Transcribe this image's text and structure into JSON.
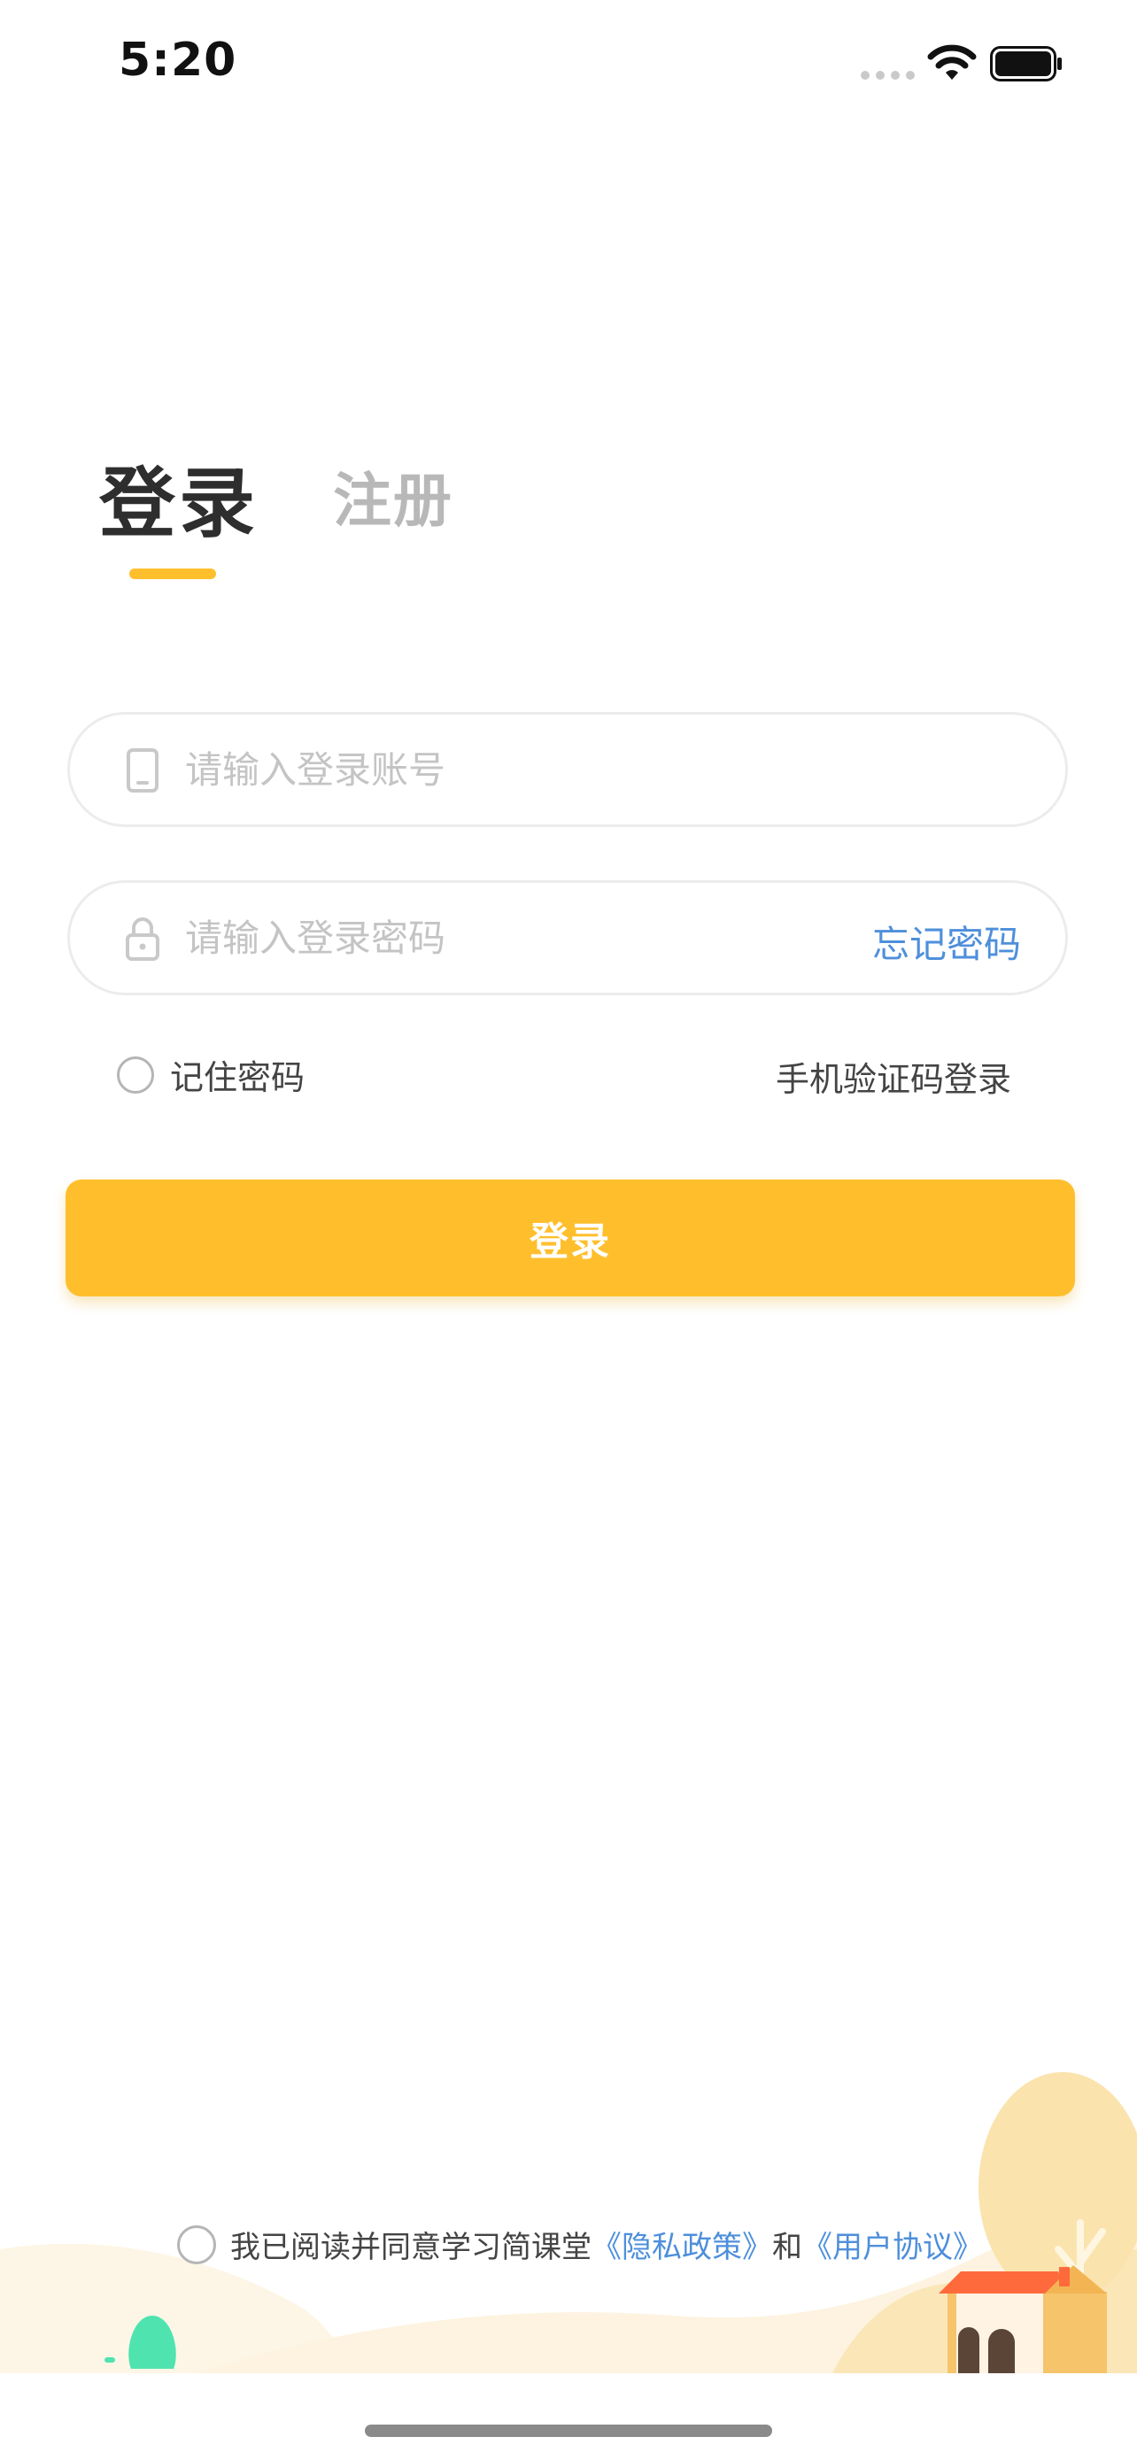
{
  "status_bar": {
    "time": "5:20",
    "icons": [
      "signal-icon",
      "wifi-icon",
      "battery-icon"
    ]
  },
  "tabs": {
    "login": "登录",
    "register": "注册",
    "active": "login"
  },
  "form": {
    "account_placeholder": "请输入登录账号",
    "account_value": "",
    "account_icon": "phone-icon",
    "password_placeholder": "请输入登录密码",
    "password_value": "",
    "password_icon": "lock-icon",
    "forgot_label": "忘记密码",
    "remember_label": "记住密码",
    "remember_checked": false,
    "sms_login_label": "手机验证码登录",
    "submit_label": "登录"
  },
  "agreement": {
    "checked": false,
    "prefix": "我已阅读并同意学习简课堂",
    "privacy_link": "《隐私政策》",
    "conjunction": "和",
    "terms_link": "《用户协议》"
  },
  "colors": {
    "accent": "#ffbf2d",
    "link": "#4e8fdb",
    "tab_active": "#2e2e2e",
    "tab_inactive": "#b8b8b8"
  }
}
